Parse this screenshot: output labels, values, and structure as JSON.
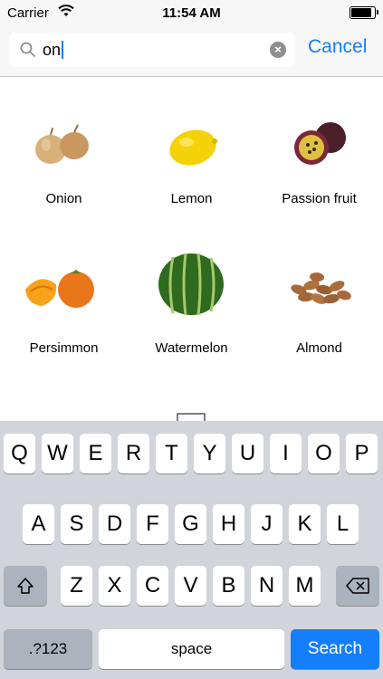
{
  "status": {
    "carrier": "Carrier",
    "time": "11:54 AM"
  },
  "search": {
    "query": "on",
    "cancel_label": "Cancel"
  },
  "results": [
    {
      "label": "Onion"
    },
    {
      "label": "Lemon"
    },
    {
      "label": "Passion fruit"
    },
    {
      "label": "Persimmon"
    },
    {
      "label": "Watermelon"
    },
    {
      "label": "Almond"
    }
  ],
  "keyboard": {
    "row1": [
      "Q",
      "W",
      "E",
      "R",
      "T",
      "Y",
      "U",
      "I",
      "O",
      "P"
    ],
    "row2": [
      "A",
      "S",
      "D",
      "F",
      "G",
      "H",
      "J",
      "K",
      "L"
    ],
    "row3": [
      "Z",
      "X",
      "C",
      "V",
      "B",
      "N",
      "M"
    ],
    "numbers_label": ".?123",
    "space_label": "space",
    "search_label": "Search"
  }
}
